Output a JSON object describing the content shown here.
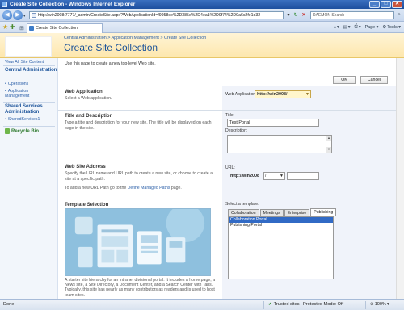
{
  "window": {
    "title": "Create Site Collection - Windows Internet Explorer",
    "min_glyph": "_",
    "max_glyph": "□",
    "close_glyph": "✕"
  },
  "address": {
    "back_glyph": "◀",
    "forward_glyph": "▶",
    "dropdown_glyph": "▾",
    "url": "http://win2008:7777/_admin/CreateSite.aspx?WebApplicationId=f9958ee%2D385e%2D4ea1%2D9f74%2D9a6c2fe1d32",
    "refresh_glyph": "↻",
    "stop_glyph": "✕",
    "search_placeholder": "DAEMON Search",
    "search_glyph": "⌕"
  },
  "tabs": {
    "favorite_glyph": "★",
    "add_favorite_glyph": "✚",
    "grid_glyph": "⊞",
    "page_tab": "Create Site Collection",
    "commands": [
      {
        "icon": "⌂",
        "label": "▾"
      },
      {
        "icon": "▤",
        "label": "▾"
      },
      {
        "icon": "⎙",
        "label": "▾"
      },
      {
        "icon": "",
        "label": "Page ▾"
      },
      {
        "icon": "⚙",
        "label": "Tools ▾"
      }
    ]
  },
  "header": {
    "breadcrumb": "Central Administration > Application Management > Create Site Collection",
    "title": "Create Site Collection"
  },
  "leftnav": {
    "view_all": "View All Site Content",
    "sections": [
      {
        "title": "Central Administration",
        "items": [
          "Operations",
          "Application Management"
        ]
      },
      {
        "title": "Shared Services Administration",
        "items": [
          "SharedServices1"
        ]
      }
    ],
    "recycle_bin": "Recycle Bin"
  },
  "main": {
    "intro": "Use this page to create a new top-level Web site.",
    "ok_label": "OK",
    "cancel_label": "Cancel",
    "web_application": {
      "title": "Web Application",
      "desc": "Select a Web application.",
      "label": "Web Application:",
      "value": "http://win2008/"
    },
    "title_desc": {
      "title": "Title and Description",
      "desc": "Type a title and description for your new site. The title will be displayed on each page in the site.",
      "title_label": "Title:",
      "title_value": "Test Portal",
      "description_label": "Description:",
      "description_value": ""
    },
    "web_site_address": {
      "title": "Web Site Address",
      "desc": "Specify the URL name and URL path to create a new site, or choose to create a site at a specific path.",
      "managed_paths_prefix": "To add a new URL Path go to the ",
      "managed_paths_link": "Define Managed Paths",
      "managed_paths_suffix": " page.",
      "url_label": "URL:",
      "url_prefix": "http://win2008",
      "url_path": "/",
      "url_value": ""
    },
    "template_selection": {
      "title": "Template Selection",
      "desc": "A starter site hierarchy for an intranet divisional portal. It includes a home page, a News site, a Site Directory, a Document Center, and a Search Center with Tabs. Typically, this site has nearly as many contributors as readers and is used to host team sites.",
      "select_label": "Select a template:",
      "tabs": [
        "Collaboration",
        "Meetings",
        "Enterprise",
        "Publishing"
      ],
      "active_tab": "Publishing",
      "options": [
        "Collaboration Portal",
        "Publishing Portal"
      ],
      "selected_option": "Collaboration Portal"
    }
  },
  "statusbar": {
    "status": "Done",
    "zone": "Trusted sites | Protected Mode: Off",
    "zoom": "100%"
  },
  "colors": {
    "accent": "#1a5299",
    "header_bg": "#fde7ae",
    "field_panel_bg": "#f0f3fa",
    "selection": "#316ac5"
  }
}
